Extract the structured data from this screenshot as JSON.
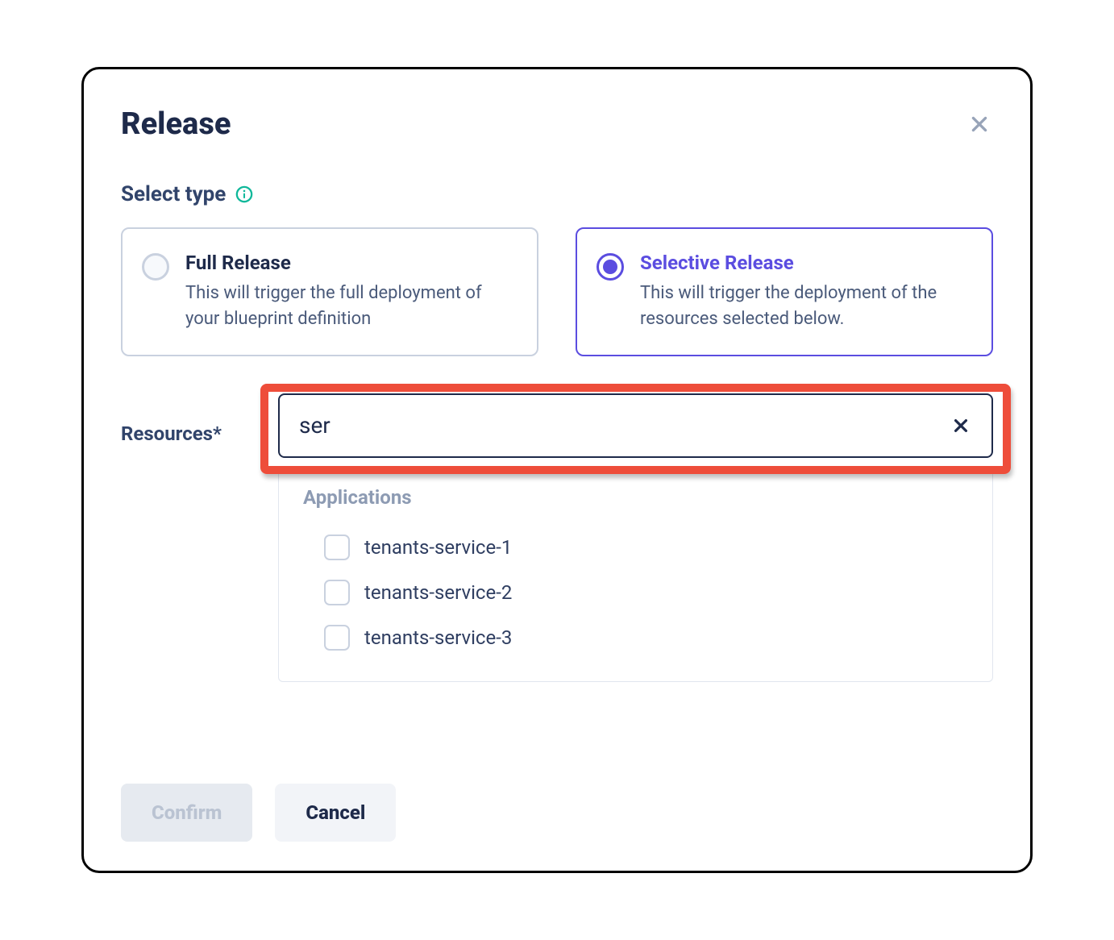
{
  "dialog": {
    "title": "Release",
    "section_label": "Select type",
    "options": {
      "full": {
        "title": "Full Release",
        "desc": "This will trigger the full deployment of your blueprint definition"
      },
      "selective": {
        "title": "Selective Release",
        "desc": "This will trigger the deployment of the resources selected below."
      }
    },
    "resources_label": "Resources*",
    "search_value": "ser",
    "group_label": "Applications",
    "items": [
      {
        "label": "tenants-service-1"
      },
      {
        "label": "tenants-service-2"
      },
      {
        "label": "tenants-service-3"
      }
    ],
    "confirm_label": "Confirm",
    "cancel_label": "Cancel"
  }
}
